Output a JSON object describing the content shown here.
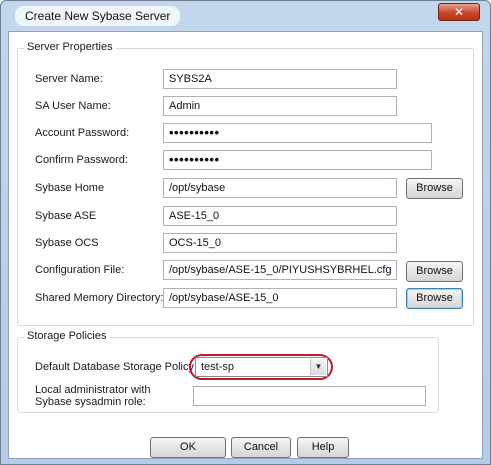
{
  "window": {
    "title": "Create New Sybase Server",
    "close_glyph": "✕"
  },
  "server_properties": {
    "title": "Server Properties",
    "server_name": {
      "label": "Server Name:",
      "value": "SYBS2A"
    },
    "sa_user_name": {
      "label": "SA User Name:",
      "value": "Admin"
    },
    "account_password": {
      "label": "Account Password:",
      "value": "••••••••••"
    },
    "confirm_password": {
      "label": "Confirm Password:",
      "value": "••••••••••"
    },
    "sybase_home": {
      "label": "Sybase Home",
      "value": "/opt/sybase",
      "button": "Browse"
    },
    "sybase_ase": {
      "label": "Sybase ASE",
      "value": "ASE-15_0"
    },
    "sybase_ocs": {
      "label": "Sybase OCS",
      "value": "OCS-15_0"
    },
    "configuration_file": {
      "label": "Configuration File:",
      "value": "/opt/sybase/ASE-15_0/PIYUSHSYBRHEL.cfg",
      "button": "Browse"
    },
    "shared_memory_directory": {
      "label": "Shared Memory Directory:",
      "value": "/opt/sybase/ASE-15_0",
      "button": "Browse"
    }
  },
  "storage_policies": {
    "title": "Storage Policies",
    "default_policy": {
      "label": "Default Database Storage Policy:",
      "value": "test-sp",
      "arrow": "▼"
    },
    "local_admin": {
      "label_line1": "Local administrator with",
      "label_line2": "Sybase sysadmin role:",
      "value": ""
    }
  },
  "buttons": {
    "ok": "OK",
    "cancel": "Cancel",
    "help": "Help"
  },
  "colors": {
    "highlight": "#c0192a",
    "titlebar": "#c3d6ec",
    "close": "#c7472a"
  }
}
